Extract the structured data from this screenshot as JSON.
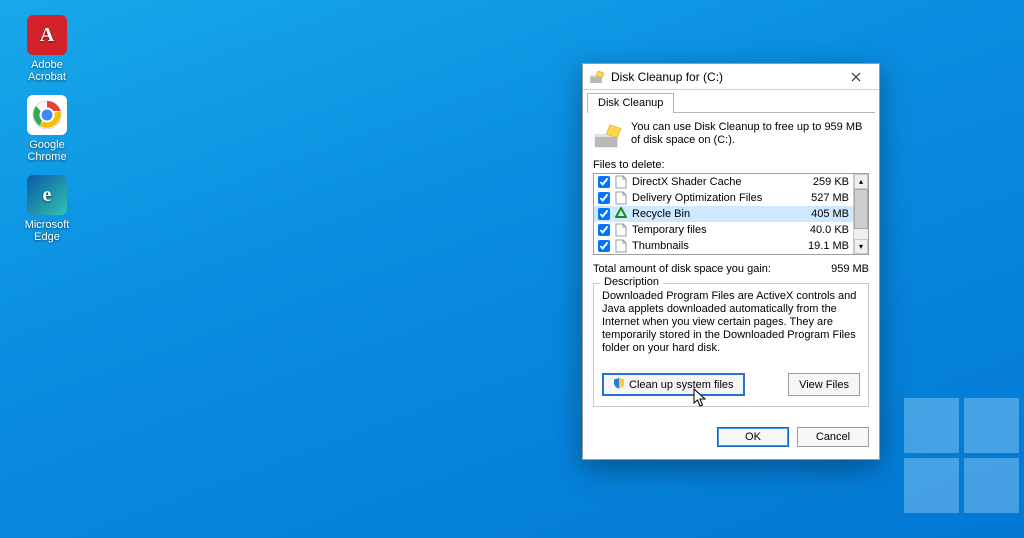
{
  "desktop": {
    "icons": [
      {
        "name": "adobe-acrobat",
        "label": "Adobe Acrobat",
        "iconClass": "ic-acrobat",
        "glyph": "A"
      },
      {
        "name": "google-chrome",
        "label": "Google Chrome",
        "iconClass": "ic-chrome",
        "glyph": ""
      },
      {
        "name": "microsoft-edge",
        "label": "Microsoft Edge",
        "iconClass": "ic-edge",
        "glyph": "e"
      }
    ]
  },
  "dialog": {
    "title": "Disk Cleanup for  (C:)",
    "tab_label": "Disk Cleanup",
    "info_text": "You can use Disk Cleanup to free up to 959 MB of disk space on  (C:).",
    "files_to_delete_label": "Files to delete:",
    "items": [
      {
        "label": "DirectX Shader Cache",
        "size": "259 KB",
        "checked": true,
        "icon": "file",
        "selected": false
      },
      {
        "label": "Delivery Optimization Files",
        "size": "527 MB",
        "checked": true,
        "icon": "file",
        "selected": false
      },
      {
        "label": "Recycle Bin",
        "size": "405 MB",
        "checked": true,
        "icon": "recycle",
        "selected": true
      },
      {
        "label": "Temporary files",
        "size": "40.0 KB",
        "checked": true,
        "icon": "file",
        "selected": false
      },
      {
        "label": "Thumbnails",
        "size": "19.1 MB",
        "checked": true,
        "icon": "file",
        "selected": false
      }
    ],
    "total_label": "Total amount of disk space you gain:",
    "total_value": "959 MB",
    "description_label": "Description",
    "description_text": "Downloaded Program Files are ActiveX controls and Java applets downloaded automatically from the Internet when you view certain pages. They are temporarily stored in the Downloaded Program Files folder on your hard disk.",
    "cleanup_btn": "Clean up system files",
    "viewfiles_btn": "View Files",
    "ok_btn": "OK",
    "cancel_btn": "Cancel"
  }
}
